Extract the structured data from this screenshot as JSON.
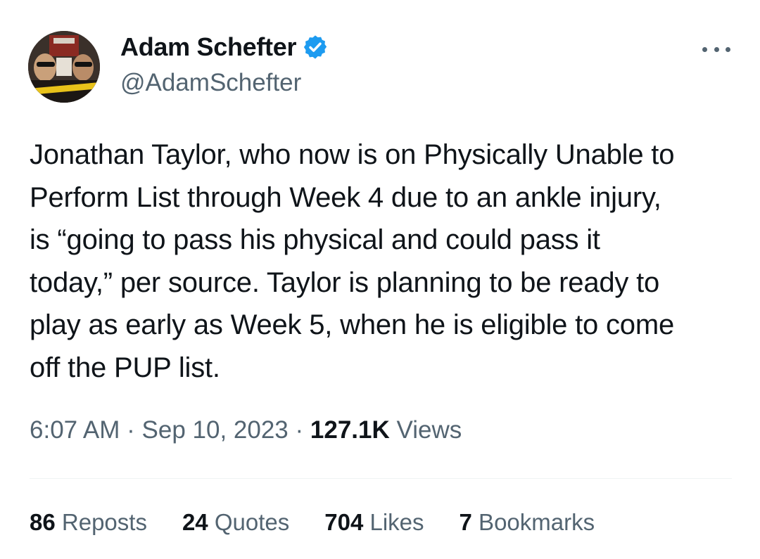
{
  "author": {
    "display_name": "Adam Schefter",
    "handle": "@AdamSchefter",
    "avatar_icon": "profile-photo",
    "verified_icon": "verified-badge-icon",
    "verified_color": "#1d9bf0"
  },
  "more_icon": "more-options-icon",
  "tweet": {
    "text": "Jonathan Taylor, who now is on Physically Unable to\nPerform List through Week 4 due to an ankle injury,\nis “going to pass his physical and could pass it\ntoday,” per source. Taylor is planning to be ready to\nplay as early as Week 5, when he is eligible to come\noff the PUP list."
  },
  "meta": {
    "time": "6:07 AM",
    "separator": " · ",
    "date": "Sep 10, 2023",
    "views_count": "127.1K",
    "views_label": " Views"
  },
  "stats": {
    "reposts": {
      "count": "86",
      "label": " Reposts"
    },
    "quotes": {
      "count": "24",
      "label": " Quotes"
    },
    "likes": {
      "count": "704",
      "label": " Likes"
    },
    "bookmarks": {
      "count": "7",
      "label": " Bookmarks"
    }
  },
  "colors": {
    "text": "#0f1419",
    "secondary": "#536471",
    "divider": "#eff3f4"
  }
}
